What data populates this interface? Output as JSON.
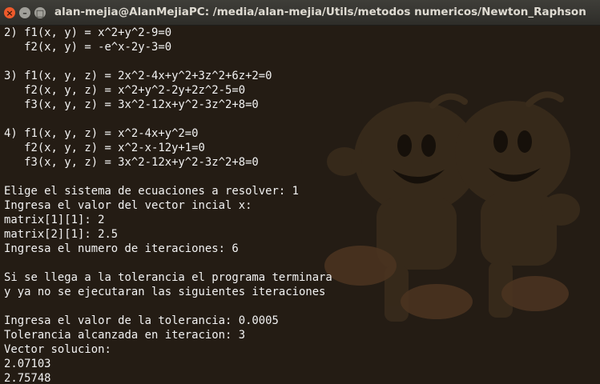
{
  "window": {
    "title": "alan-mejia@AlanMejiaPC: /media/alan-mejia/Utils/metodos numericos/Newton_Raphson",
    "close_glyph": "×",
    "minimize_glyph": "–",
    "maximize_glyph": "□"
  },
  "terminal": {
    "lines": [
      "2) f1(x, y) = x^2+y^2-9=0",
      "   f2(x, y) = -e^x-2y-3=0",
      "",
      "3) f1(x, y, z) = 2x^2-4x+y^2+3z^2+6z+2=0",
      "   f2(x, y, z) = x^2+y^2-2y+2z^2-5=0",
      "   f3(x, y, z) = 3x^2-12x+y^2-3z^2+8=0",
      "",
      "4) f1(x, y, z) = x^2-4x+y^2=0",
      "   f2(x, y, z) = x^2-x-12y+1=0",
      "   f3(x, y, z) = 3x^2-12x+y^2-3z^2+8=0",
      "",
      "Elige el sistema de ecuaciones a resolver: 1",
      "Ingresa el valor del vector incial x:",
      "matrix[1][1]: 2",
      "matrix[2][1]: 2.5",
      "Ingresa el numero de iteraciones: 6",
      "",
      "Si se llega a la tolerancia el programa terminara",
      "y ya no se ejecutaran las siguientes iteraciones",
      "",
      "Ingresa el valor de la tolerancia: 0.0005",
      "Tolerancia alcanzada en iteracion: 3",
      "Vector solucion:",
      "2.07103",
      "2.75748"
    ]
  },
  "colors": {
    "terminal_bg": "#241c14",
    "text": "#f2f2f2",
    "titlebar": "#3a3935",
    "close_button": "#ee5a2b"
  }
}
